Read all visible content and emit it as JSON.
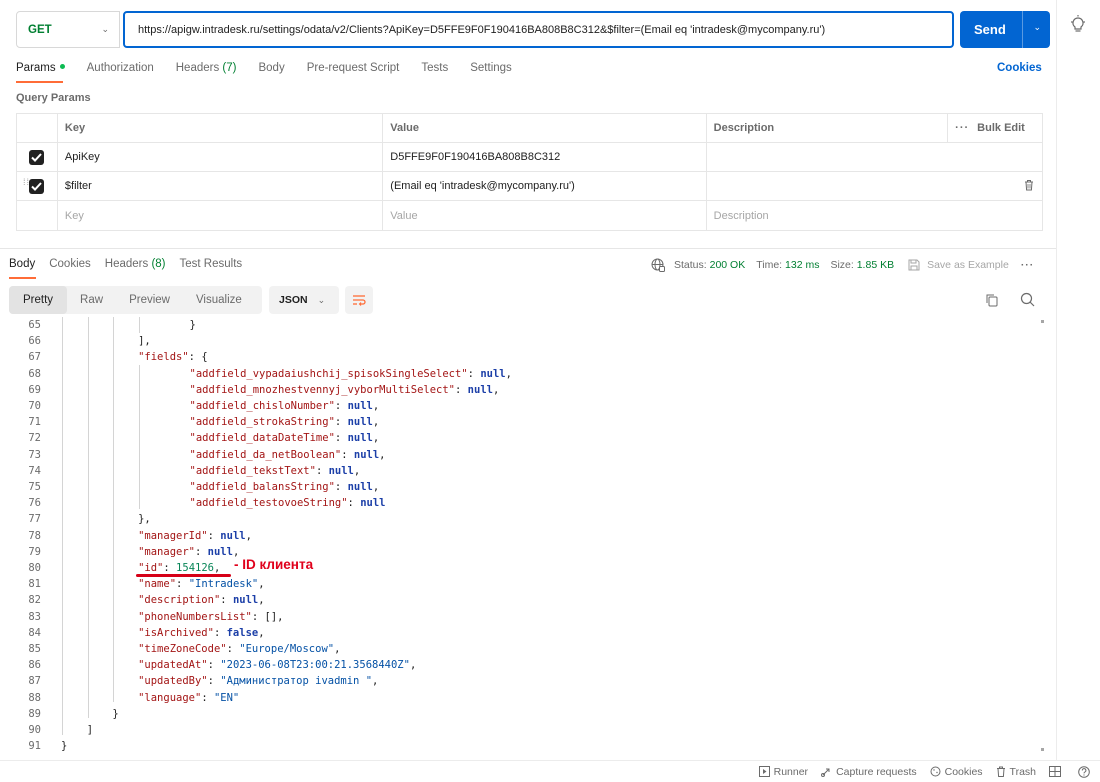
{
  "request": {
    "method": "GET",
    "url": "https://apigw.intradesk.ru/settings/odata/v2/Clients?ApiKey=D5FFE9F0F190416BA808B8C312&$filter=(Email eq 'intradesk@mycompany.ru')",
    "send_label": "Send"
  },
  "req_tabs": [
    {
      "label": "Params",
      "active": true
    },
    {
      "label": "Authorization"
    },
    {
      "label": "Headers",
      "count": "(7)"
    },
    {
      "label": "Body"
    },
    {
      "label": "Pre-request Script"
    },
    {
      "label": "Tests"
    },
    {
      "label": "Settings"
    }
  ],
  "cookies_label": "Cookies",
  "query_params_title": "Query Params",
  "params_table": {
    "headers": {
      "key": "Key",
      "value": "Value",
      "description": "Description",
      "bulk_edit": "Bulk Edit"
    },
    "rows": [
      {
        "key": "ApiKey",
        "value": "D5FFE9F0F190416BA808B8C312",
        "checked": true
      },
      {
        "key": "$filter",
        "value": "(Email eq 'intradesk@mycompany.ru')",
        "checked": true
      }
    ],
    "placeholder": {
      "key": "Key",
      "value": "Value",
      "description": "Description"
    }
  },
  "resp_tabs": [
    {
      "label": "Body",
      "active": true
    },
    {
      "label": "Cookies"
    },
    {
      "label": "Headers",
      "count": "(8)"
    },
    {
      "label": "Test Results"
    }
  ],
  "status": {
    "status_label": "Status:",
    "status_value": "200 OK",
    "time_label": "Time:",
    "time_value": "132 ms",
    "size_label": "Size:",
    "size_value": "1.85 KB",
    "save_example": "Save as Example"
  },
  "body_toolbar": {
    "modes": [
      "Pretty",
      "Raw",
      "Preview",
      "Visualize"
    ],
    "format": "JSON"
  },
  "annotation": "- ID клиента",
  "footer": {
    "runner": "Runner",
    "capture": "Capture requests",
    "cookies": "Cookies",
    "trash": "Trash"
  },
  "code_lines": [
    {
      "n": "65",
      "indent": 10,
      "tokens": [
        [
          "p",
          "}"
        ]
      ]
    },
    {
      "n": "66",
      "indent": 6,
      "tokens": [
        [
          "p",
          "],"
        ]
      ]
    },
    {
      "n": "67",
      "indent": 6,
      "tokens": [
        [
          "k",
          "\"fields\""
        ],
        [
          "p",
          ": {"
        ]
      ]
    },
    {
      "n": "68",
      "indent": 10,
      "tokens": [
        [
          "k",
          "\"addfield_vypadaiushchij_spisokSingleSelect\""
        ],
        [
          "p",
          ": "
        ],
        [
          "b",
          "null"
        ],
        [
          "p",
          ","
        ]
      ]
    },
    {
      "n": "69",
      "indent": 10,
      "tokens": [
        [
          "k",
          "\"addfield_mnozhestvennyj_vyborMultiSelect\""
        ],
        [
          "p",
          ": "
        ],
        [
          "b",
          "null"
        ],
        [
          "p",
          ","
        ]
      ]
    },
    {
      "n": "70",
      "indent": 10,
      "tokens": [
        [
          "k",
          "\"addfield_chisloNumber\""
        ],
        [
          "p",
          ": "
        ],
        [
          "b",
          "null"
        ],
        [
          "p",
          ","
        ]
      ]
    },
    {
      "n": "71",
      "indent": 10,
      "tokens": [
        [
          "k",
          "\"addfield_strokaString\""
        ],
        [
          "p",
          ": "
        ],
        [
          "b",
          "null"
        ],
        [
          "p",
          ","
        ]
      ]
    },
    {
      "n": "72",
      "indent": 10,
      "tokens": [
        [
          "k",
          "\"addfield_dataDateTime\""
        ],
        [
          "p",
          ": "
        ],
        [
          "b",
          "null"
        ],
        [
          "p",
          ","
        ]
      ]
    },
    {
      "n": "73",
      "indent": 10,
      "tokens": [
        [
          "k",
          "\"addfield_da_netBoolean\""
        ],
        [
          "p",
          ": "
        ],
        [
          "b",
          "null"
        ],
        [
          "p",
          ","
        ]
      ]
    },
    {
      "n": "74",
      "indent": 10,
      "tokens": [
        [
          "k",
          "\"addfield_tekstText\""
        ],
        [
          "p",
          ": "
        ],
        [
          "b",
          "null"
        ],
        [
          "p",
          ","
        ]
      ]
    },
    {
      "n": "75",
      "indent": 10,
      "tokens": [
        [
          "k",
          "\"addfield_balansString\""
        ],
        [
          "p",
          ": "
        ],
        [
          "b",
          "null"
        ],
        [
          "p",
          ","
        ]
      ]
    },
    {
      "n": "76",
      "indent": 10,
      "tokens": [
        [
          "k",
          "\"addfield_testovoeString\""
        ],
        [
          "p",
          ": "
        ],
        [
          "b",
          "null"
        ]
      ]
    },
    {
      "n": "77",
      "indent": 6,
      "tokens": [
        [
          "p",
          "},"
        ]
      ]
    },
    {
      "n": "78",
      "indent": 6,
      "tokens": [
        [
          "k",
          "\"managerId\""
        ],
        [
          "p",
          ": "
        ],
        [
          "b",
          "null"
        ],
        [
          "p",
          ","
        ]
      ]
    },
    {
      "n": "79",
      "indent": 6,
      "tokens": [
        [
          "k",
          "\"manager\""
        ],
        [
          "p",
          ": "
        ],
        [
          "b",
          "null"
        ],
        [
          "p",
          ","
        ]
      ]
    },
    {
      "n": "80",
      "indent": 6,
      "tokens": [
        [
          "k",
          "\"id\""
        ],
        [
          "p",
          ": "
        ],
        [
          "n",
          "154126"
        ],
        [
          "p",
          ","
        ]
      ]
    },
    {
      "n": "81",
      "indent": 6,
      "tokens": [
        [
          "k",
          "\"name\""
        ],
        [
          "p",
          ": "
        ],
        [
          "s",
          "\"Intradesk\""
        ],
        [
          "p",
          ","
        ]
      ]
    },
    {
      "n": "82",
      "indent": 6,
      "tokens": [
        [
          "k",
          "\"description\""
        ],
        [
          "p",
          ": "
        ],
        [
          "b",
          "null"
        ],
        [
          "p",
          ","
        ]
      ]
    },
    {
      "n": "83",
      "indent": 6,
      "tokens": [
        [
          "k",
          "\"phoneNumbersList\""
        ],
        [
          "p",
          ": [],"
        ]
      ]
    },
    {
      "n": "84",
      "indent": 6,
      "tokens": [
        [
          "k",
          "\"isArchived\""
        ],
        [
          "p",
          ": "
        ],
        [
          "b",
          "false"
        ],
        [
          "p",
          ","
        ]
      ]
    },
    {
      "n": "85",
      "indent": 6,
      "tokens": [
        [
          "k",
          "\"timeZoneCode\""
        ],
        [
          "p",
          ": "
        ],
        [
          "s",
          "\"Europe/Moscow\""
        ],
        [
          "p",
          ","
        ]
      ]
    },
    {
      "n": "86",
      "indent": 6,
      "tokens": [
        [
          "k",
          "\"updatedAt\""
        ],
        [
          "p",
          ": "
        ],
        [
          "s",
          "\"2023-06-08T23:00:21.3568440Z\""
        ],
        [
          "p",
          ","
        ]
      ]
    },
    {
      "n": "87",
      "indent": 6,
      "tokens": [
        [
          "k",
          "\"updatedBy\""
        ],
        [
          "p",
          ": "
        ],
        [
          "s",
          "\"Администратор ivadmin \""
        ],
        [
          "p",
          ","
        ]
      ]
    },
    {
      "n": "88",
      "indent": 6,
      "tokens": [
        [
          "k",
          "\"language\""
        ],
        [
          "p",
          ": "
        ],
        [
          "s",
          "\"EN\""
        ]
      ]
    },
    {
      "n": "89",
      "indent": 4,
      "tokens": [
        [
          "p",
          "}"
        ]
      ]
    },
    {
      "n": "90",
      "indent": 2,
      "tokens": [
        [
          "p",
          "]"
        ]
      ]
    },
    {
      "n": "91",
      "indent": 0,
      "tokens": [
        [
          "p",
          "}"
        ]
      ]
    }
  ]
}
